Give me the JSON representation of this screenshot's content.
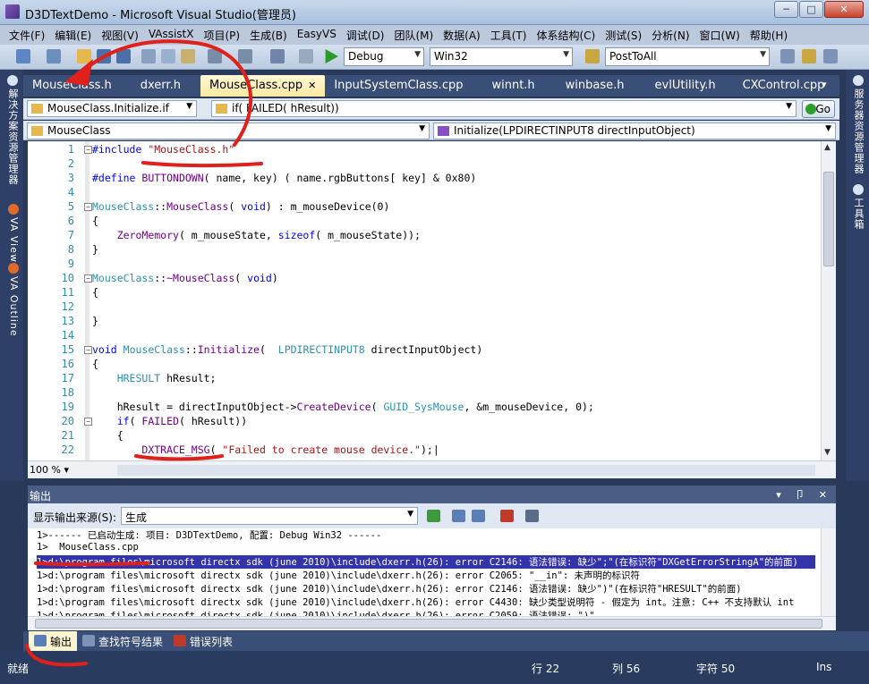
{
  "window": {
    "title": "D3DTextDemo - Microsoft Visual Studio(管理员)",
    "minimize": "─",
    "maximize": "□",
    "close": "✕"
  },
  "menu": [
    "文件(F)",
    "编辑(E)",
    "视图(V)",
    "VAssistX",
    "项目(P)",
    "生成(B)",
    "EasyVS",
    "调试(D)",
    "团队(M)",
    "数据(A)",
    "工具(T)",
    "体系结构(C)",
    "测试(S)",
    "分析(N)",
    "窗口(W)",
    "帮助(H)"
  ],
  "toolbar": {
    "config": "Debug",
    "platform": "Win32",
    "find": "PostToAll"
  },
  "left_tabs": [
    "解决方案资源管理器",
    "VA View",
    "VA Outline"
  ],
  "right_tabs": [
    "服务器资源管理器",
    "工具箱"
  ],
  "doc_tabs": [
    "MouseClass.h",
    "dxerr.h",
    "MouseClass.cpp",
    "InputSystemClass.cpp",
    "winnt.h",
    "winbase.h",
    "evlUtility.h",
    "CXControl.cpp"
  ],
  "active_tab_close": "✕",
  "tabs_menu": "▾",
  "nav": {
    "va_context": "MouseClass.Initialize.if",
    "va_def": "if( FAILED( hResult))",
    "go": "Go",
    "class_scope": "MouseClass",
    "member": "Initialize(LPDIRECTINPUT8 directInputObject)"
  },
  "code": [
    {
      "n": "1",
      "t": "#include \"MouseClass.h\""
    },
    {
      "n": "2",
      "t": ""
    },
    {
      "n": "3",
      "t": "#define BUTTONDOWN( name, key) ( name.rgbButtons[ key] & 0x80)"
    },
    {
      "n": "4",
      "t": ""
    },
    {
      "n": "5",
      "t": "MouseClass::MouseClass( void) : m_mouseDevice(0)"
    },
    {
      "n": "6",
      "t": "{"
    },
    {
      "n": "7",
      "t": "    ZeroMemory( m_mouseState, sizeof( m_mouseState));"
    },
    {
      "n": "8",
      "t": "}"
    },
    {
      "n": "9",
      "t": ""
    },
    {
      "n": "10",
      "t": "MouseClass::~MouseClass( void)"
    },
    {
      "n": "11",
      "t": "{"
    },
    {
      "n": "12",
      "t": ""
    },
    {
      "n": "13",
      "t": "}"
    },
    {
      "n": "14",
      "t": ""
    },
    {
      "n": "15",
      "t": "void MouseClass::Initialize(  LPDIRECTINPUT8 directInputObject)"
    },
    {
      "n": "16",
      "t": "{"
    },
    {
      "n": "17",
      "t": "    HRESULT hResult;"
    },
    {
      "n": "18",
      "t": ""
    },
    {
      "n": "19",
      "t": "    hResult = directInputObject->CreateDevice( GUID_SysMouse, &m_mouseDevice, 0);"
    },
    {
      "n": "20",
      "t": "    if( FAILED( hResult))"
    },
    {
      "n": "21",
      "t": "    {"
    },
    {
      "n": "22",
      "t": "        DXTRACE_MSG( \"Failed to create mouse device.\");"
    }
  ],
  "zoom": "100 %",
  "output": {
    "title": "输出",
    "source_label": "显示输出来源(S):",
    "source_value": "生成",
    "lines": [
      "1>------ 已启动生成: 项目: D3DTextDemo, 配置: Debug Win32 ------",
      "1>  MouseClass.cpp",
      "1>d:\\program files\\microsoft directx sdk (june 2010)\\include\\dxerr.h(26): error C2146: 语法错误: 缺少\";\"(在标识符\"DXGetErrorStringA\"的前面)",
      "1>d:\\program files\\microsoft directx sdk (june 2010)\\include\\dxerr.h(26): error C2065: \"__in\": 未声明的标识符",
      "1>d:\\program files\\microsoft directx sdk (june 2010)\\include\\dxerr.h(26): error C2146: 语法错误: 缺少\")\"(在标识符\"HRESULT\"的前面)",
      "1>d:\\program files\\microsoft directx sdk (june 2010)\\include\\dxerr.h(26): error C4430: 缺少类型说明符 - 假定为 int。注意: C++ 不支持默认 int",
      "1>d:\\program files\\microsoft directx sdk (june 2010)\\include\\dxerr.h(26): error C2059: 语法错误: \")\""
    ],
    "header_controls": "▾ 卩 ✕"
  },
  "tool_tabs": [
    "输出",
    "查找符号结果",
    "错误列表"
  ],
  "status": {
    "ready": "就绪",
    "line": "行 22",
    "col": "列 56",
    "ch": "字符 50",
    "ins": "Ins"
  },
  "colors": {
    "annotation": "#e0201a",
    "selection": "#3333aa",
    "ide_frame": "#2f4068"
  }
}
